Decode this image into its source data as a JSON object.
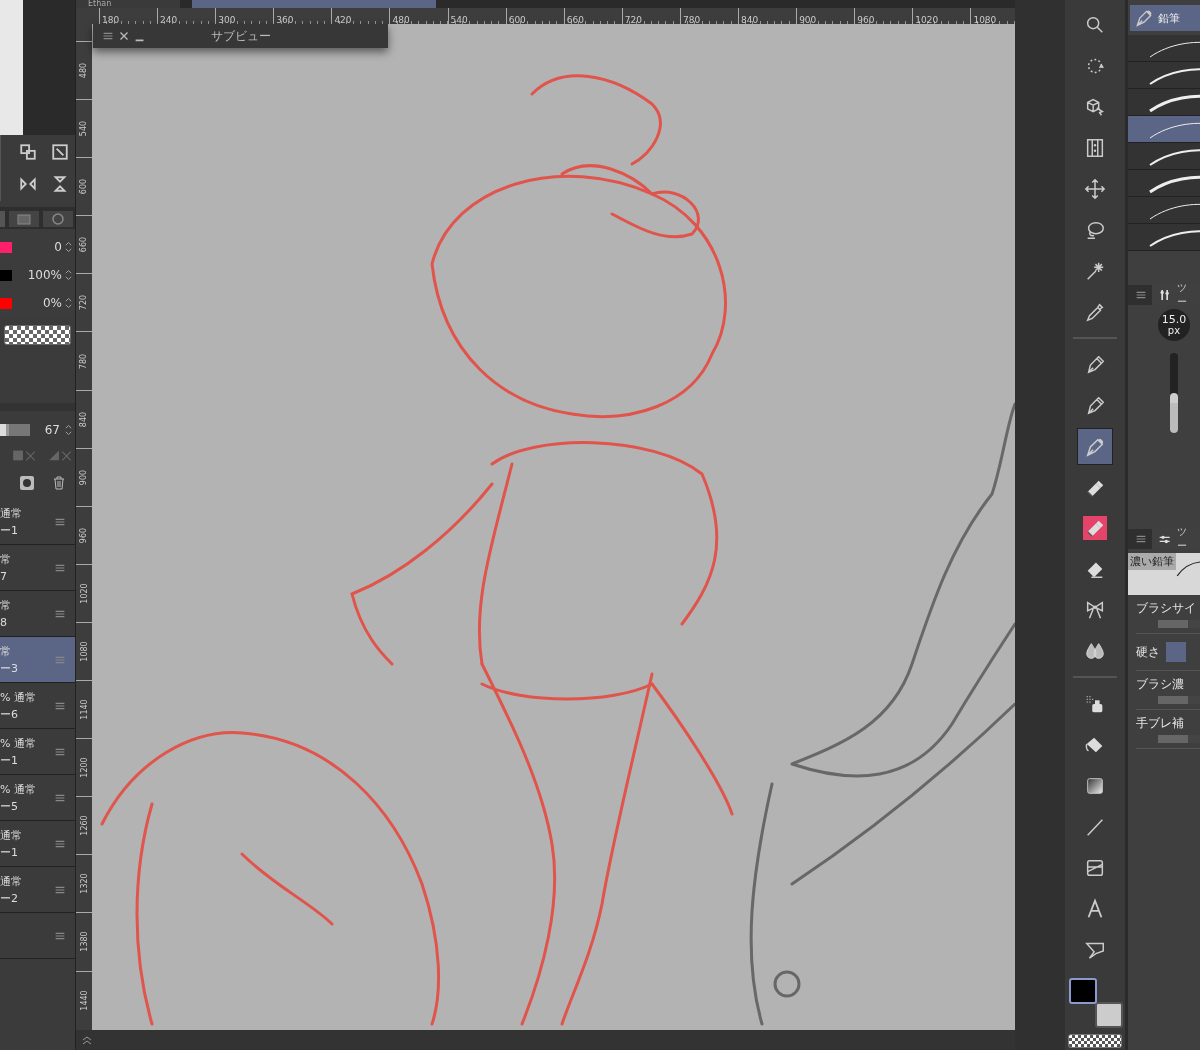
{
  "document_tabs": [
    {
      "label": "Ethan",
      "selected": false
    },
    {
      "selected": true
    }
  ],
  "rulers": {
    "horizontal": [
      "180",
      "240",
      "300",
      "360",
      "420",
      "480",
      "540",
      "600",
      "660",
      "720",
      "780",
      "840",
      "900",
      "960",
      "1020",
      "1080"
    ],
    "vertical": [
      "480",
      "540",
      "600",
      "660",
      "720",
      "780",
      "840",
      "900",
      "960",
      "1020",
      "1080",
      "1140",
      "1200",
      "1260",
      "1320",
      "1380",
      "1440"
    ]
  },
  "subview": {
    "title": "サブビュー"
  },
  "left_panel": {
    "color_rows": [
      {
        "color": "#ff1f6a",
        "value": "0"
      },
      {
        "color": "#000000",
        "value": "100%"
      },
      {
        "color": "#ff0000",
        "value": "0%"
      }
    ],
    "opacity": {
      "level": 0.3,
      "value": "67"
    },
    "layers": [
      {
        "mode": "通常",
        "name": "ー1",
        "selected": false
      },
      {
        "mode": "常",
        "name": "7",
        "selected": false
      },
      {
        "mode": "常",
        "name": "8",
        "selected": false
      },
      {
        "mode": "常",
        "name": "ー3",
        "selected": true
      },
      {
        "mode": "% 通常",
        "name": "ー6",
        "selected": false
      },
      {
        "mode": "% 通常",
        "name": "ー1",
        "selected": false
      },
      {
        "mode": "% 通常",
        "name": "ー5",
        "selected": false
      },
      {
        "mode": "通常",
        "name": "ー1",
        "selected": false
      },
      {
        "mode": "通常",
        "name": "ー2",
        "selected": false
      },
      {
        "selected": false
      }
    ]
  },
  "toolbar": {
    "groups": [
      {
        "tools": [
          {
            "kind": "zoom",
            "selected": false,
            "highlighted": false
          },
          {
            "kind": "rotate",
            "selected": false,
            "highlighted": false
          },
          {
            "kind": "cube",
            "selected": false,
            "highlighted": false
          },
          {
            "kind": "frame",
            "selected": false,
            "highlighted": false
          },
          {
            "kind": "move",
            "selected": false,
            "highlighted": false
          },
          {
            "kind": "lasso",
            "selected": false,
            "highlighted": false
          },
          {
            "kind": "wand",
            "selected": false,
            "highlighted": false
          },
          {
            "kind": "dropper",
            "selected": false,
            "highlighted": false
          }
        ]
      },
      {
        "tools": [
          {
            "kind": "pen",
            "selected": false,
            "highlighted": false
          },
          {
            "kind": "pen",
            "selected": false,
            "highlighted": false
          },
          {
            "kind": "pencil",
            "selected": true,
            "highlighted": false
          },
          {
            "kind": "marker",
            "selected": false,
            "highlighted": false
          },
          {
            "kind": "marker",
            "selected": false,
            "highlighted": true
          },
          {
            "kind": "eraser",
            "selected": false,
            "highlighted": false
          },
          {
            "kind": "bow",
            "selected": false,
            "highlighted": false
          },
          {
            "kind": "drops",
            "selected": false,
            "highlighted": false
          }
        ]
      },
      {
        "tools": [
          {
            "kind": "spray",
            "selected": false,
            "highlighted": false
          },
          {
            "kind": "bucket",
            "selected": false,
            "highlighted": false
          },
          {
            "kind": "gradient",
            "selected": false,
            "highlighted": false
          },
          {
            "kind": "line",
            "selected": false,
            "highlighted": false
          },
          {
            "kind": "ruler",
            "selected": false,
            "highlighted": false
          },
          {
            "kind": "text",
            "selected": false,
            "highlighted": false
          },
          {
            "kind": "balloon",
            "selected": false,
            "highlighted": false
          }
        ]
      }
    ],
    "colors": [
      {
        "color": "#000000",
        "selected": true
      },
      {
        "color": "#cccccc",
        "selected": false
      }
    ]
  },
  "brush_panel": {
    "title": "鉛筆",
    "brushes": [
      {
        "selected": false
      },
      {
        "selected": false
      },
      {
        "selected": false
      },
      {
        "selected": true
      },
      {
        "selected": false
      },
      {
        "selected": false
      },
      {
        "selected": false
      },
      {
        "selected": false
      }
    ]
  },
  "tool_property": {
    "tab": "ツー",
    "size": "15.0",
    "unit": "px",
    "level": 0.5
  },
  "sub_tool_detail": {
    "tab": "ツー",
    "preview_label": "濃い鉛筆",
    "properties": [
      {
        "label": "ブラシサイ",
        "kind": "slider",
        "level": 0.6
      },
      {
        "label": "硬さ",
        "kind": "swatch"
      },
      {
        "label": "ブラシ濃",
        "kind": "slider",
        "level": 0.6
      },
      {
        "label": "手ブレ補",
        "kind": "slider",
        "level": 0.6
      }
    ]
  }
}
